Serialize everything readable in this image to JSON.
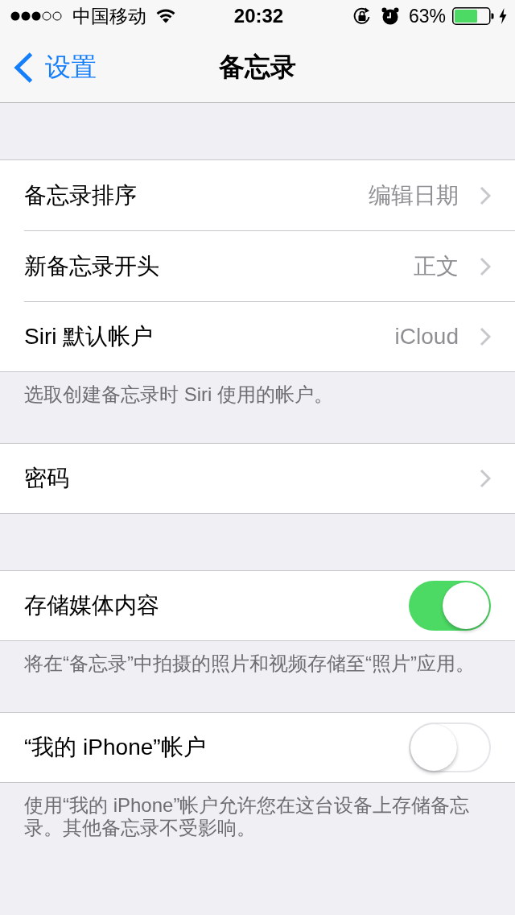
{
  "status_bar": {
    "carrier": "中国移动",
    "time": "20:32",
    "battery": "63%"
  },
  "nav_bar": {
    "back": "设置",
    "title": "备忘录"
  },
  "sections": [
    {
      "rows": [
        {
          "kind": "disclosure",
          "label": "备忘录排序",
          "value": "编辑日期"
        },
        {
          "kind": "disclosure",
          "label": "新备忘录开头",
          "value": "正文"
        },
        {
          "kind": "disclosure",
          "label": "Siri 默认帐户",
          "value": "iCloud"
        }
      ],
      "footer": "选取创建备忘录时 Siri 使用的帐户。"
    },
    {
      "rows": [
        {
          "kind": "disclosure",
          "label": "密码"
        }
      ]
    },
    {
      "rows": [
        {
          "kind": "toggle",
          "label": "存储媒体内容",
          "on": true
        }
      ],
      "footer": "将在“备忘录”中拍摄的照片和视频存储至“照片”应用。"
    },
    {
      "rows": [
        {
          "kind": "toggle",
          "label": "“我的 iPhone”帐户",
          "on": false
        }
      ],
      "footer": "使用“我的 iPhone”帐户允许您在这台设备上存储备忘录。其他备忘录不受影响。"
    }
  ]
}
